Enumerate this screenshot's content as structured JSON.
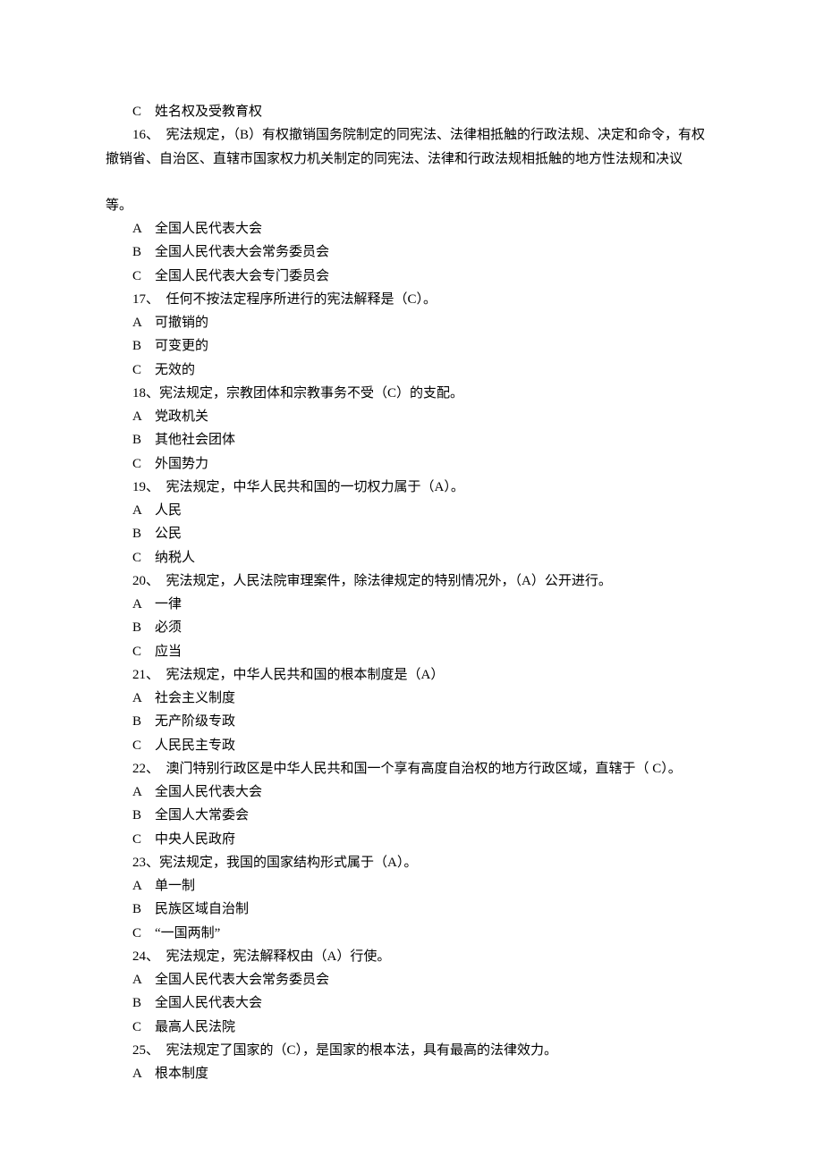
{
  "lines": [
    {
      "text": "C　姓名权及受教育权",
      "indent": true
    },
    {
      "text": "16、　宪法规定，（B）有权撤销国务院制定的同宪法、法律相抵触的行政法规、决定和命令，有权撤销省、自治区、直辖市国家权力机关制定的同宪法、法律和行政法规相抵触的地方性法规和决议",
      "indent": true
    },
    {
      "spacer": true
    },
    {
      "text": "等。",
      "indent": false
    },
    {
      "text": "A　全国人民代表大会",
      "indent": true
    },
    {
      "text": "B　全国人民代表大会常务委员会",
      "indent": true
    },
    {
      "text": "C　全国人民代表大会专门委员会",
      "indent": true
    },
    {
      "text": "17、　任何不按法定程序所进行的宪法解释是（C）。",
      "indent": true
    },
    {
      "text": "A　可撤销的",
      "indent": true
    },
    {
      "text": "B　可变更的",
      "indent": true
    },
    {
      "text": "C　无效的",
      "indent": true
    },
    {
      "text": "18、宪法规定，宗教团体和宗教事务不受（C）的支配。",
      "indent": true
    },
    {
      "text": "A　党政机关",
      "indent": true
    },
    {
      "text": "B　其他社会团体",
      "indent": true
    },
    {
      "text": "C　外国势力",
      "indent": true
    },
    {
      "text": "19、　宪法规定，中华人民共和国的一切权力属于（A）。",
      "indent": true
    },
    {
      "text": "A　人民",
      "indent": true
    },
    {
      "text": "B　公民",
      "indent": true
    },
    {
      "text": "C　纳税人",
      "indent": true
    },
    {
      "text": "20、　宪法规定，人民法院审理案件，除法律规定的特别情况外，（A）公开进行。",
      "indent": true
    },
    {
      "text": "A　一律",
      "indent": true
    },
    {
      "text": "B　必须",
      "indent": true
    },
    {
      "text": "C　应当",
      "indent": true
    },
    {
      "text": "21、　宪法规定，中华人民共和国的根本制度是（A）",
      "indent": true
    },
    {
      "text": "A　社会主义制度",
      "indent": true
    },
    {
      "text": "B　无产阶级专政",
      "indent": true
    },
    {
      "text": "C　人民民主专政",
      "indent": true
    },
    {
      "text": "22、　澳门特别行政区是中华人民共和国一个享有高度自治权的地方行政区域，直辖于（ C）。",
      "indent": true
    },
    {
      "text": "A　全国人民代表大会",
      "indent": true
    },
    {
      "text": "B　全国人大常委会",
      "indent": true
    },
    {
      "text": "C　中央人民政府",
      "indent": true
    },
    {
      "text": "23、宪法规定，我国的国家结构形式属于（A）。",
      "indent": true
    },
    {
      "text": "A　单一制",
      "indent": true
    },
    {
      "text": "B　民族区域自治制",
      "indent": true
    },
    {
      "text": "C　“一国两制”",
      "indent": true
    },
    {
      "text": "24、　宪法规定，宪法解释权由（A）行使。",
      "indent": true
    },
    {
      "text": "A　全国人民代表大会常务委员会",
      "indent": true
    },
    {
      "text": "B　全国人民代表大会",
      "indent": true
    },
    {
      "text": "C　最高人民法院",
      "indent": true
    },
    {
      "text": "25、　宪法规定了国家的（C），是国家的根本法，具有最高的法律效力。",
      "indent": true
    },
    {
      "text": "A　根本制度",
      "indent": true
    }
  ]
}
